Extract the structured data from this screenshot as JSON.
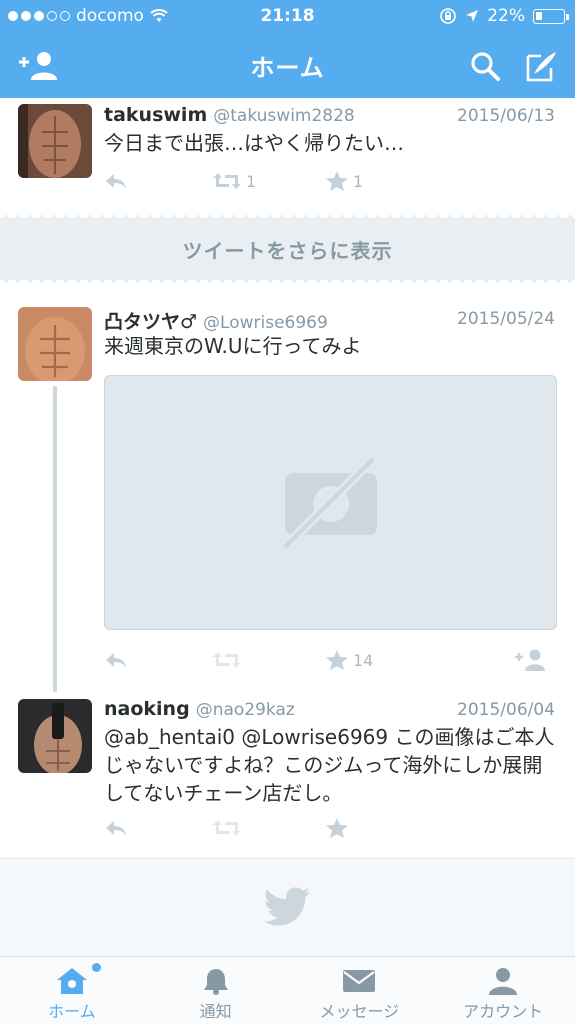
{
  "status_bar": {
    "carrier": "docomo",
    "time": "21:18",
    "battery": "22%",
    "battery_level": 0.22
  },
  "nav": {
    "title": "ホーム",
    "icons": [
      "add-user-icon",
      "search-icon",
      "compose-icon"
    ]
  },
  "tweets": [
    {
      "name": "takuswim",
      "handle": "@takuswim2828",
      "date": "2015/06/13",
      "text": "今日まで出張…はやく帰りたい…",
      "retweets": "1",
      "favorites": "1"
    },
    {
      "name": "凸タツヤ♂",
      "handle": "@Lowrise6969",
      "date": "2015/05/24",
      "text": "来週東京のW.Uに行ってみよ",
      "retweets": "",
      "favorites": "14"
    },
    {
      "name": "naoking",
      "handle": "@nao29kaz",
      "date": "2015/06/04",
      "text": "@ab_hentai0 @Lowrise6969 この画像はご本人じゃないですよね？このジムって海外にしか展開してないチェーン店だし。",
      "retweets": "",
      "favorites": ""
    }
  ],
  "gap": {
    "label": "ツイートをさらに表示"
  },
  "tabs": [
    {
      "label": "ホーム",
      "icon": "home-icon",
      "active": true
    },
    {
      "label": "通知",
      "icon": "bell-icon",
      "active": false
    },
    {
      "label": "メッセージ",
      "icon": "envelope-icon",
      "active": false
    },
    {
      "label": "アカウント",
      "icon": "person-icon",
      "active": false
    }
  ],
  "colors": {
    "accent": "#55acee",
    "muted": "#8899a6",
    "text": "#292f33"
  }
}
